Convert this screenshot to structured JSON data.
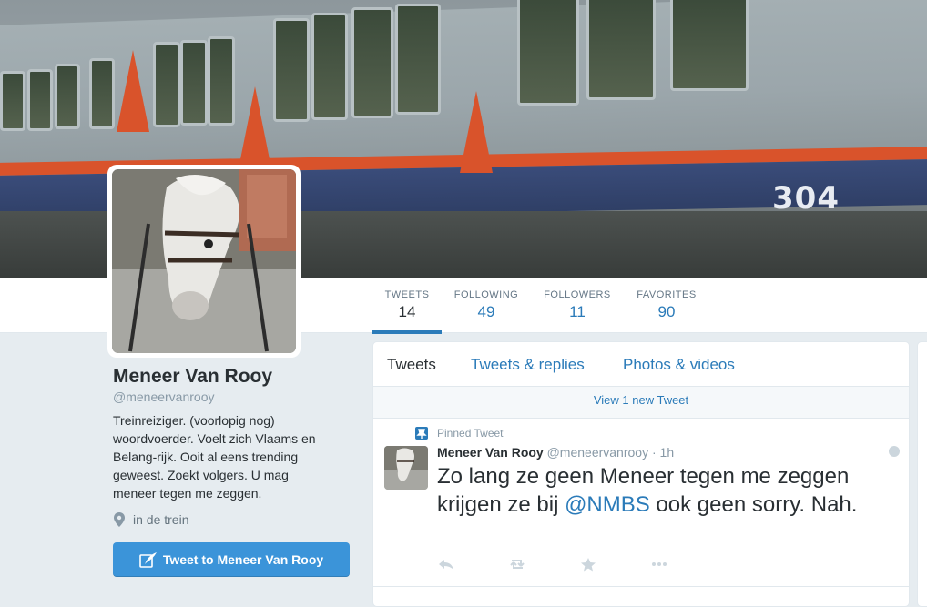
{
  "profile": {
    "name": "Meneer Van Rooy",
    "handle": "@meneervanrooy",
    "bio": "Treinreiziger. (voorlopig nog) woordvoerder. Voelt zich Vlaams en Belang-rijk. Ooit al eens trending geweest. Zoekt volgers. U mag meneer tegen me zeggen.",
    "location": "in de trein",
    "tweet_to_label": "Tweet to Meneer Van Rooy"
  },
  "banner": {
    "train_number": "304"
  },
  "stats": [
    {
      "label": "TWEETS",
      "value": "14"
    },
    {
      "label": "FOLLOWING",
      "value": "49"
    },
    {
      "label": "FOLLOWERS",
      "value": "11"
    },
    {
      "label": "FAVORITES",
      "value": "90"
    }
  ],
  "timeline": {
    "tabs": [
      "Tweets",
      "Tweets & replies",
      "Photos & videos"
    ],
    "new_tweets": "View 1 new Tweet",
    "pinned_label": "Pinned Tweet",
    "tweet": {
      "name": "Meneer Van Rooy",
      "handle": "@meneervanrooy",
      "time": "1h",
      "text_before": "Zo lang ze geen Meneer tegen me zeggen krijgen ze bij ",
      "mention": "@NMBS",
      "text_after": " ook geen sorry. Nah."
    }
  },
  "colors": {
    "link": "#2b7bb9",
    "button": "#3b94d9",
    "background": "#e6ecf0"
  },
  "icons": [
    "location-pin-icon",
    "quill-icon",
    "pin-icon",
    "reply-icon",
    "retweet-icon",
    "favorite-icon",
    "more-icon",
    "caret-icon"
  ]
}
